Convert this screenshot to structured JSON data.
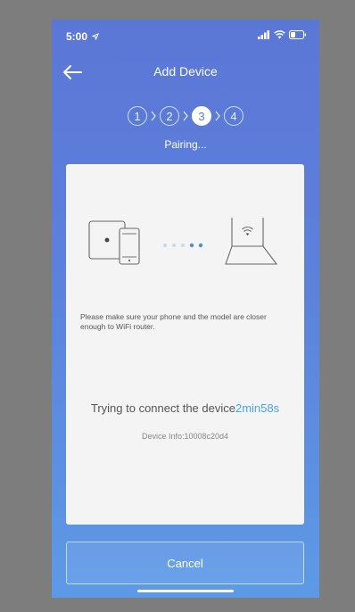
{
  "status_bar": {
    "time": "5:00",
    "icons": [
      "location-arrow-icon",
      "signal-icon",
      "wifi-icon",
      "battery-icon"
    ]
  },
  "header": {
    "back_icon": "arrow-left-icon",
    "title": "Add Device"
  },
  "steps": {
    "items": [
      "1",
      "2",
      "3",
      "4"
    ],
    "active_step": 3,
    "caption": "Pairing..."
  },
  "card": {
    "illustration": {
      "left": "device-and-phone-icon",
      "middle": "pairing-dots",
      "right": "wifi-router-icon"
    },
    "hint": "Please make sure your phone and the model are closer enough to WiFi router.",
    "connecting_text": "Trying to connect the device",
    "countdown": "2min58s",
    "device_info": "Device Info:10008c20d4"
  },
  "cancel_label": "Cancel",
  "colors": {
    "background_top": "#5b77d6",
    "background_bottom": "#5d9ae6",
    "accent": "#4aa3e8",
    "card": "#f4f4f4"
  }
}
